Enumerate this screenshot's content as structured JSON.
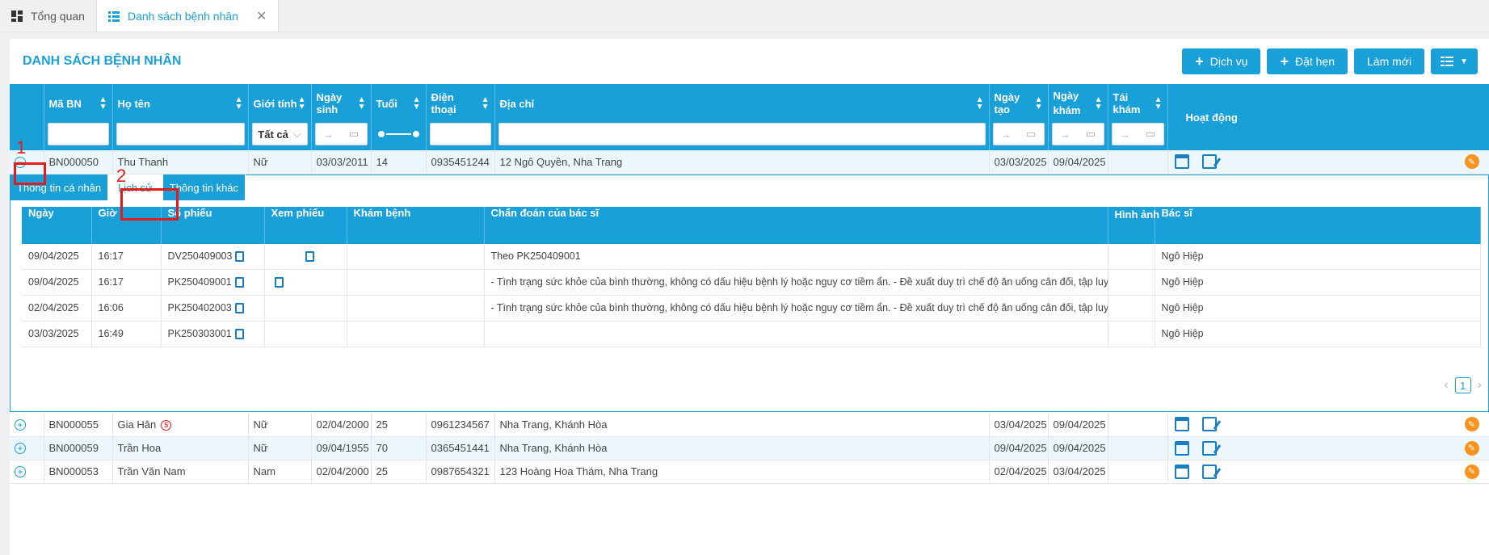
{
  "tabs": [
    {
      "label": "Tổng quan",
      "icon": "dashboard-icon"
    },
    {
      "label": "Danh sách bệnh nhân",
      "icon": "list-icon"
    }
  ],
  "panel": {
    "title": "DANH SÁCH BỆNH NHÂN"
  },
  "toolbar": {
    "service_label": "Dịch vụ",
    "appointment_label": "Đặt hẹn",
    "refresh_label": "Làm mới"
  },
  "columns": {
    "ma_bn": "Mã BN",
    "ho_ten": "Họ tên",
    "gioi_tinh": "Giới tính",
    "ngay_sinh": "Ngày sinh",
    "tuoi": "Tuổi",
    "dien_thoai": "Điện thoại",
    "dia_chi": "Địa chỉ",
    "ngay_tao": "Ngày tạo",
    "ngay_kham": "Ngày khám",
    "tai_kham": "Tái khám",
    "hoat_dong": "Hoạt động"
  },
  "filters": {
    "gender_value": "Tất cả",
    "date_arrow": "→"
  },
  "patients": [
    {
      "ma": "BN000050",
      "ten": "Thu Thanh",
      "gt": "Nữ",
      "ns": "03/03/2011",
      "tuoi": "14",
      "dt": "0935451244",
      "dc": "12 Ngô Quyền, Nha Trang",
      "tao": "03/03/2025",
      "kham": "09/04/2025"
    },
    {
      "ma": "BN000055",
      "ten": "Gia Hân",
      "gt": "Nữ",
      "ns": "02/04/2000",
      "tuoi": "25",
      "dt": "0961234567",
      "dc": "Nha Trang, Khánh Hòa",
      "tao": "03/04/2025",
      "kham": "09/04/2025"
    },
    {
      "ma": "BN000059",
      "ten": "Trần Hoa",
      "gt": "Nữ",
      "ns": "09/04/1955",
      "tuoi": "70",
      "dt": "0365451441",
      "dc": "Nha Trang, Khánh Hòa",
      "tao": "09/04/2025",
      "kham": "09/04/2025"
    },
    {
      "ma": "BN000053",
      "ten": "Trần Văn Nam",
      "gt": "Nam",
      "ns": "02/04/2000",
      "tuoi": "25",
      "dt": "0987654321",
      "dc": "123 Hoàng Hoa Thám, Nha Trang",
      "tao": "02/04/2025",
      "kham": "03/04/2025"
    }
  ],
  "annotations": {
    "one": "1",
    "two": "2"
  },
  "detail_tabs": [
    "Thông tin cá nhân",
    "Lịch sử",
    "Thông tin khác"
  ],
  "history_columns": {
    "ngay": "Ngày",
    "gio": "Giờ",
    "so_phieu": "Số phiếu",
    "xem_phieu": "Xem phiếu",
    "kham_benh": "Khám bệnh",
    "chan_doan": "Chẩn đoán của bác sĩ",
    "hinh_anh": "Hình ảnh",
    "bac_si": "Bác sĩ"
  },
  "history": [
    {
      "ngay": "09/04/2025",
      "gio": "16:17",
      "so": "DV250409003",
      "cd": "Theo PK250409001",
      "bs": "Ngô Hiệp"
    },
    {
      "ngay": "09/04/2025",
      "gio": "16:17",
      "so": "PK250409001",
      "cd": "- Tình trạng sức khỏe của bình thường, không có dấu hiệu bệnh lý hoặc nguy cơ tiềm ẩn. - Đề xuất duy trì chế độ ăn uống cân đối, tập luyện đều đặn - Tái khám định kỳ theo khuyến cáo.",
      "bs": "Ngô Hiệp"
    },
    {
      "ngay": "02/04/2025",
      "gio": "16:06",
      "so": "PK250402003",
      "cd": "- Tình trạng sức khỏe của bình thường, không có dấu hiệu bệnh lý hoặc nguy cơ tiềm ẩn. - Đề xuất duy trì chế độ ăn uống cân đối, tập luyện đều đặn - Tái khám định kỳ theo khuyến cáo.",
      "bs": "Ngô Hiệp"
    },
    {
      "ngay": "03/03/2025",
      "gio": "16:49",
      "so": "PK250303001",
      "cd": "",
      "bs": "Ngô Hiệp"
    }
  ],
  "pager": {
    "current": "1"
  }
}
